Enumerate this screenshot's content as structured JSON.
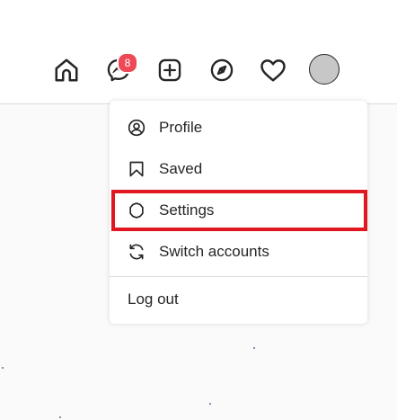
{
  "nav": {
    "icons": [
      "home-icon",
      "messenger-icon",
      "new-post-icon",
      "explore-icon",
      "activity-heart-icon"
    ],
    "messenger_badge": "8"
  },
  "menu": {
    "items": [
      {
        "label": "Profile",
        "icon": "profile-icon"
      },
      {
        "label": "Saved",
        "icon": "bookmark-icon"
      },
      {
        "label": "Settings",
        "icon": "settings-gear-icon"
      },
      {
        "label": "Switch accounts",
        "icon": "switch-accounts-icon"
      }
    ],
    "logout_label": "Log out"
  },
  "colors": {
    "badge": "#ed4956",
    "highlight_outline": "#e0171e",
    "text": "#262626",
    "background": "#fafafa"
  }
}
